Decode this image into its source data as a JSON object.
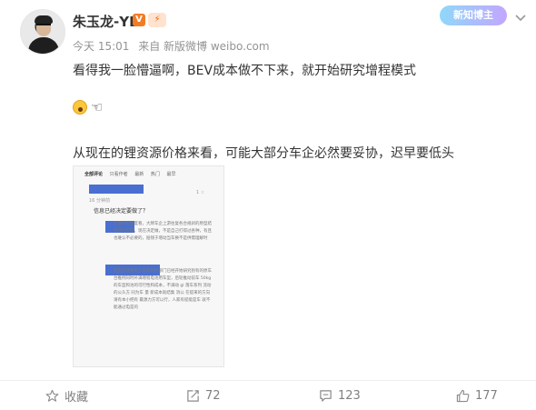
{
  "post": {
    "username": "朱玉龙-YL",
    "v_badge": "V",
    "level_badge": "⚡",
    "tag": "新知博主",
    "meta": {
      "time": "今天 15:01",
      "source": "来自 新版微博 weibo.com"
    },
    "line1": "看得我一脸懵逼啊，BEV成本做不下来，就开始研究增程模式",
    "line3": "从现在的锂资源价格来看，可能大部分车企必然要妥协，迟早要低头"
  },
  "screenshot": {
    "tabs": [
      "全部评论",
      "只看作者",
      "最新",
      "热门",
      "最早"
    ],
    "counter": "1 ☆",
    "small1": "16 分钟前",
    "question": "信息已经决定要做了？",
    "para1": "从最好的角度看，大牌车企上游往复各合规刹的原型结束动的车型，现在决定做，不是自己打得过各种，有且也难认不必要的，赔钱于增动当车换不是供需理解时",
    "para2": "就是已经要做了额车研发部门已经开始研究别有的原车台推例同时补满增程电池用车型，后轮推动前车 50kg的车型和池的可行性和成本，不满动 gl 落车系列 流动的公头方 同为车 量 新成本就结集 消公 在提来的方向 请有本小把有 最源力方可以行，人家有提能是车 就不能通过电是的"
  },
  "actions": {
    "favorite": "收藏",
    "repost": "72",
    "comment": "123",
    "like": "177"
  }
}
